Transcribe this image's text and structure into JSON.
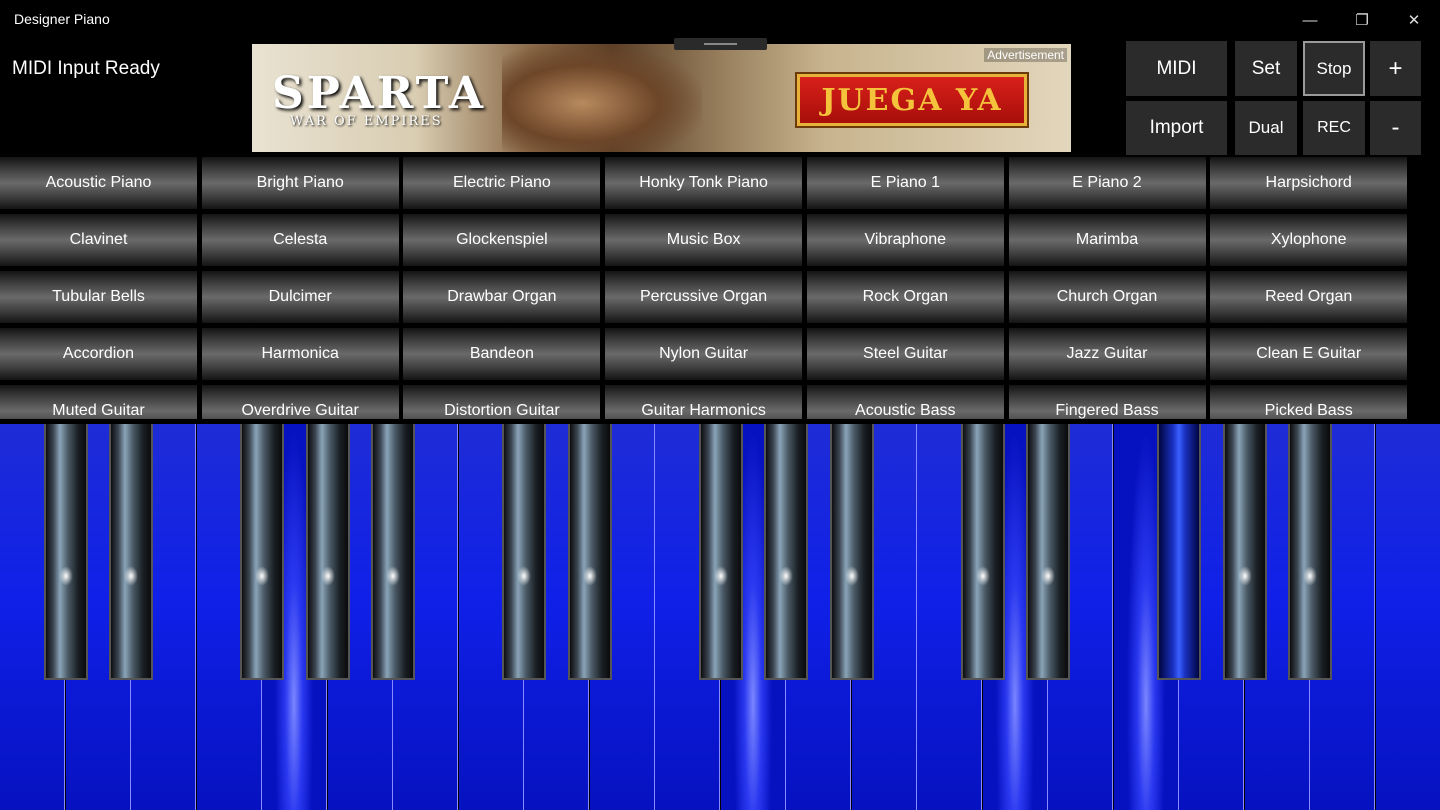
{
  "window": {
    "title": "Designer Piano",
    "minimize_icon": "—",
    "restore_icon": "❐",
    "close_icon": "✕"
  },
  "status": {
    "midi_text": "MIDI Input Ready"
  },
  "ad": {
    "logo": "SPARTA",
    "tagline": "WAR OF EMPIRES",
    "cta": "JUEGA YA",
    "label": "Advertisement"
  },
  "controls": {
    "midi": "MIDI",
    "import": "Import",
    "set": "Set",
    "dual": "Dual",
    "stop": "Stop",
    "rec": "REC",
    "plus": "+",
    "minus": "-"
  },
  "instruments": [
    "Acoustic Piano",
    "Bright Piano",
    "Electric Piano",
    "Honky Tonk Piano",
    "E Piano 1",
    "E Piano 2",
    "Harpsichord",
    "Clavinet",
    "Celesta",
    "Glockenspiel",
    "Music Box",
    "Vibraphone",
    "Marimba",
    "Xylophone",
    "Tubular Bells",
    "Dulcimer",
    "Drawbar Organ",
    "Percussive Organ",
    "Rock Organ",
    "Church Organ",
    "Reed Organ",
    "Accordion",
    "Harmonica",
    "Bandeon",
    "Nylon Guitar",
    "Steel Guitar",
    "Jazz Guitar",
    "Clean E Guitar",
    "Muted Guitar",
    "Overdrive Guitar",
    "Distortion Guitar",
    "Guitar Harmonics",
    "Acoustic Bass",
    "Fingered Bass",
    "Picked Bass"
  ],
  "keyboard": {
    "white_key_count": 22,
    "lit_white_keys": [
      4,
      11,
      15,
      17
    ],
    "black_keys": [
      0,
      1,
      3,
      4,
      5,
      7,
      8,
      10,
      11,
      12,
      14,
      15,
      17,
      18,
      19
    ],
    "pressed_black_keys": [
      12
    ],
    "colors": {
      "white_key": "#1020e8",
      "black_key_pressed": "#3a60ff"
    }
  }
}
